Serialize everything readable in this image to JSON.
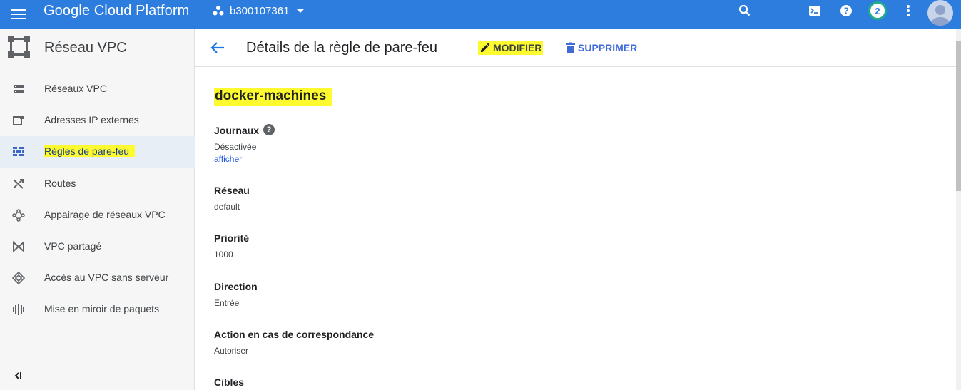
{
  "topbar": {
    "app_title": "Google Cloud Platform",
    "project_name": "b300107361",
    "notifications_count": "2",
    "accent_color": "#2d7ddf"
  },
  "sidebar": {
    "title": "Réseau VPC",
    "items": [
      {
        "label": "Réseaux VPC",
        "icon": "vpc-networks-icon"
      },
      {
        "label": "Adresses IP externes",
        "icon": "external-ip-icon"
      },
      {
        "label": "Règles de pare-feu",
        "icon": "firewall-icon",
        "active": true
      },
      {
        "label": "Routes",
        "icon": "routes-icon"
      },
      {
        "label": "Appairage de réseaux VPC",
        "icon": "peering-icon"
      },
      {
        "label": "VPC partagé",
        "icon": "shared-vpc-icon"
      },
      {
        "label": "Accès au VPC sans serveur",
        "icon": "serverless-access-icon"
      },
      {
        "label": "Mise en miroir de paquets",
        "icon": "packet-mirroring-icon"
      }
    ]
  },
  "main": {
    "page_title": "Détails de la règle de pare-feu",
    "edit_label": "MODIFIER",
    "delete_label": "SUPPRIMER",
    "rule_name": "docker-machines",
    "fields": {
      "logs_label": "Journaux",
      "logs_value": "Désactivée",
      "logs_link": "afficher",
      "network_label": "Réseau",
      "network_value": "default",
      "priority_label": "Priorité",
      "priority_value": "1000",
      "direction_label": "Direction",
      "direction_value": "Entrée",
      "action_label": "Action en cas de correspondance",
      "action_value": "Autoriser",
      "targets_label": "Cibles"
    }
  }
}
